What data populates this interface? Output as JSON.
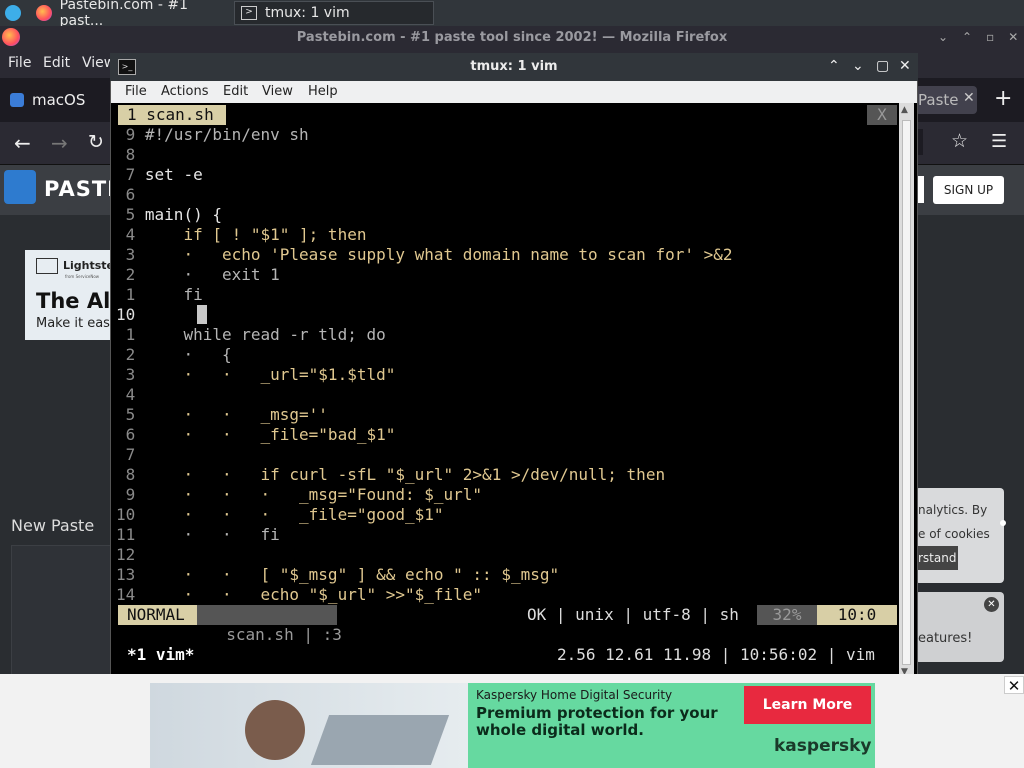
{
  "taskbar": {
    "firefox_task": "Pastebin.com - #1 past...",
    "tmux_task": "tmux: 1 vim"
  },
  "firefox": {
    "window_title": "Pastebin.com - #1 paste tool since 2002! — Mozilla Firefox",
    "menu": [
      "File",
      "Edit",
      "View"
    ],
    "tab_left": "macOS",
    "tab_right": "Paste",
    "signup": "SIGN UP",
    "logo_text": "PASTE",
    "new_paste": "New Paste",
    "side_ad_brand": "Lightstep",
    "side_ad_sub": "from ServiceNow",
    "side_ad_head": "The All",
    "side_ad_body": "Make it eas",
    "cookie_line1": "nalytics. By",
    "cookie_line2": "e of cookies",
    "cookie_btn": "rstand",
    "features_text": "eatures!"
  },
  "terminal": {
    "title": "tmux: 1 vim",
    "menu": [
      "File",
      "Actions",
      "Edit",
      "View",
      "Help"
    ],
    "tab_label": "1 scan.sh",
    "close_x": "X",
    "lines": [
      {
        "n": " 9",
        "t": "#!/usr/bin/env sh"
      },
      {
        "n": " 8",
        "t": ""
      },
      {
        "n": " 7",
        "t": "set -e"
      },
      {
        "n": " 6",
        "t": ""
      },
      {
        "n": " 5",
        "t": "main() {"
      },
      {
        "n": " 4",
        "t": "    if [ ! \"$1\" ]; then"
      },
      {
        "n": " 3",
        "t": "    ·   echo 'Please supply what domain name to scan for' >&2"
      },
      {
        "n": " 2",
        "t": "    ·   exit 1"
      },
      {
        "n": " 1",
        "t": "    fi"
      },
      {
        "n": "10",
        "t": "    "
      },
      {
        "n": " 1",
        "t": "    while read -r tld; do"
      },
      {
        "n": " 2",
        "t": "    ·   {"
      },
      {
        "n": " 3",
        "t": "    ·   ·   _url=\"$1.$tld\""
      },
      {
        "n": " 4",
        "t": ""
      },
      {
        "n": " 5",
        "t": "    ·   ·   _msg=''"
      },
      {
        "n": " 6",
        "t": "    ·   ·   _file=\"bad_$1\""
      },
      {
        "n": " 7",
        "t": ""
      },
      {
        "n": " 8",
        "t": "    ·   ·   if curl -sfL \"$_url\" 2>&1 >/dev/null; then"
      },
      {
        "n": " 9",
        "t": "    ·   ·   ·   _msg=\"Found: $_url\""
      },
      {
        "n": "10",
        "t": "    ·   ·   ·   _file=\"good_$1\""
      },
      {
        "n": "11",
        "t": "    ·   ·   fi"
      },
      {
        "n": "12",
        "t": ""
      },
      {
        "n": "13",
        "t": "    ·   ·   [ \"$_msg\" ] && echo \" :: $_msg\""
      },
      {
        "n": "14",
        "t": "    ·   ·   echo \"$_url\" >>\"$_file\""
      }
    ],
    "status": {
      "mode": "NORMAL",
      "file": "scan.sh",
      "col": ":3",
      "right": "OK | unix | utf-8 | sh",
      "percent": "32%",
      "pos": "10:0"
    },
    "tmux_bar": {
      "window": "*1 vim*",
      "info": "2.56 12.61 11.98 | 10:56:02 | vim"
    }
  },
  "ad": {
    "brand_line": "Kaspersky Home Digital Security",
    "headline1": "Premium protection for your",
    "headline2": "whole digital world.",
    "cta": "Learn More",
    "logo": "kaspersky"
  }
}
